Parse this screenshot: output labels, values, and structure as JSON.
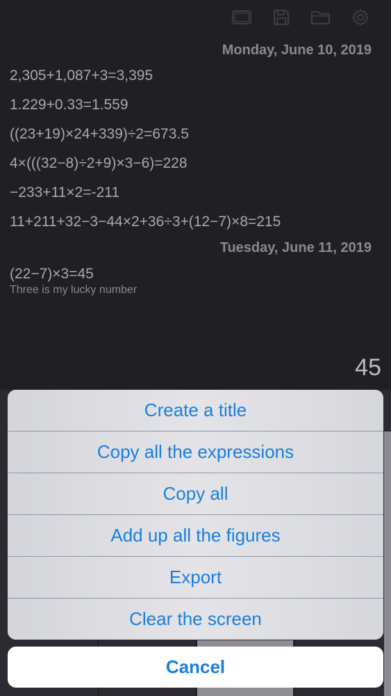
{
  "toolbar": {
    "icons": [
      "screen-icon",
      "save-icon",
      "folder-icon",
      "gear-icon"
    ]
  },
  "history": {
    "groups": [
      {
        "date": "Monday, June 10, 2019",
        "entries": [
          "2,305+1,087+3=3,395",
          "1.229+0.33=1.559",
          "((23+19)×24+339)÷2=673.5",
          "4×(((32−8)÷2+9)×3−6)=228",
          "−233+11×2=-211",
          "11+211+32−3−44×2+36÷3+(12−7)×8=215"
        ]
      },
      {
        "date": "Tuesday, June 11, 2019",
        "entries": [
          {
            "expression": "(22−7)×3=45",
            "note": "Three is my lucky number"
          }
        ]
      }
    ]
  },
  "display": {
    "result": "45"
  },
  "action_sheet": {
    "items": [
      "Create a title",
      "Copy all the expressions",
      "Copy all",
      "Add up all the figures",
      "Export",
      "Clear the screen"
    ],
    "cancel": "Cancel"
  },
  "colors": {
    "background": "#1f1f24",
    "accent": "#1a7ee0",
    "sheet": "#dcdce0"
  }
}
